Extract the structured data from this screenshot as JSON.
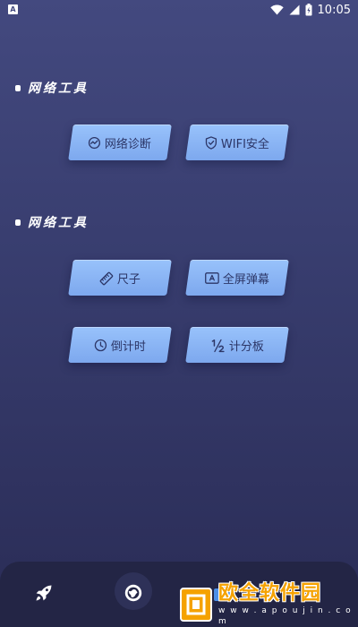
{
  "status_bar": {
    "left_icon_letter": "A",
    "time": "10:05",
    "icons": [
      "wifi-icon",
      "signal-icon",
      "battery-icon"
    ]
  },
  "sections": [
    {
      "title": "网络工具",
      "tools": [
        {
          "label": "网络诊断",
          "icon": "network-diagnosis-icon"
        },
        {
          "label": "WIFI安全",
          "icon": "shield-icon"
        }
      ]
    },
    {
      "title": "网络工具",
      "tools": [
        {
          "label": "尺子",
          "icon": "ruler-icon"
        },
        {
          "label": "全屏弹幕",
          "icon": "barrage-icon"
        },
        {
          "label": "倒计时",
          "icon": "clock-icon"
        },
        {
          "label": "计分板",
          "icon": "fraction-icon"
        }
      ]
    }
  ],
  "bottom_nav": {
    "items": [
      "rocket-icon",
      "globe-icon",
      "toolbox-icon",
      "user-icon"
    ],
    "active_index": 1
  },
  "watermark": {
    "title": "欧全软件园",
    "url": "w w w . a p o u j i n . c o m"
  },
  "colors": {
    "background_top": "#43497f",
    "background_bottom": "#2a2c56",
    "button_fill": "#98c2fb",
    "button_text": "#2c3667",
    "nav_bg": "#232545",
    "watermark_orange": "#f5a200"
  }
}
